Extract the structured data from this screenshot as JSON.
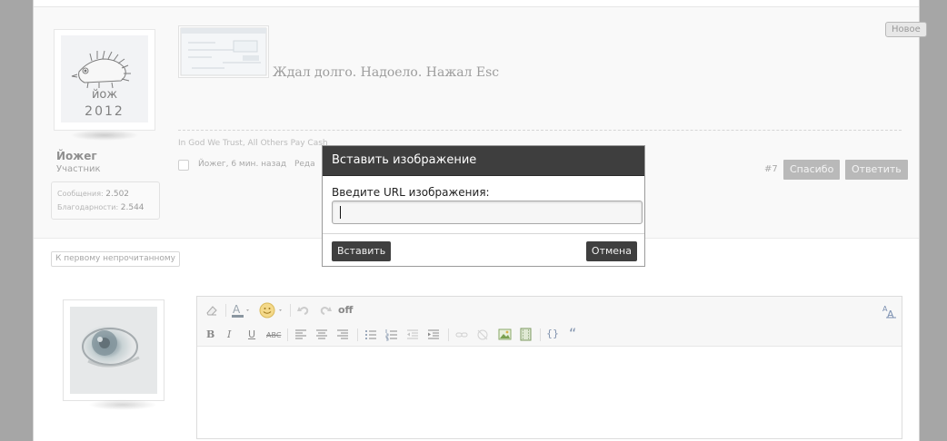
{
  "post": {
    "new_badge": "Новое",
    "text": "Ждал долго. Надоело. Нажал Esc",
    "signature": "In God We Trust, All Others Pay Cash",
    "meta": "Йожег, 6 мин. назад",
    "meta_tail": "Реда",
    "post_number": "#7",
    "thanks_button": "Спасибо",
    "reply_button": "Ответить"
  },
  "user": {
    "name": "Йожег",
    "role": "Участник",
    "avatar_text_top": "йож",
    "avatar_year": "2012",
    "stats": [
      {
        "label": "Сообщения:",
        "value": "2.502"
      },
      {
        "label": "Благодарности:",
        "value": "2.544"
      }
    ]
  },
  "first_unread": "К первому непрочитанному",
  "editor": {
    "off_label": "off",
    "toolbar_row1": [
      "eraser-icon",
      "font-color-icon",
      "smiley-icon",
      "undo-icon",
      "redo-icon"
    ],
    "toolbar_row2": [
      "bold-icon",
      "italic-icon",
      "underline-icon",
      "strikethrough-icon",
      "align-left-icon",
      "align-center-icon",
      "align-right-icon",
      "bullet-list-icon",
      "numbered-list-icon",
      "outdent-icon",
      "indent-icon",
      "link-icon",
      "unlink-icon",
      "image-icon",
      "media-icon",
      "code-icon",
      "quote-icon"
    ],
    "font_size_icon": "AA",
    "bold": "B",
    "italic": "I",
    "underline": "U",
    "strike": "ABC",
    "code": "{}",
    "quote": "“"
  },
  "dialog": {
    "title": "Вставить изображение",
    "label": "Введите URL изображения:",
    "url_value": "",
    "insert_button": "Вставить",
    "cancel_button": "Отмена"
  }
}
